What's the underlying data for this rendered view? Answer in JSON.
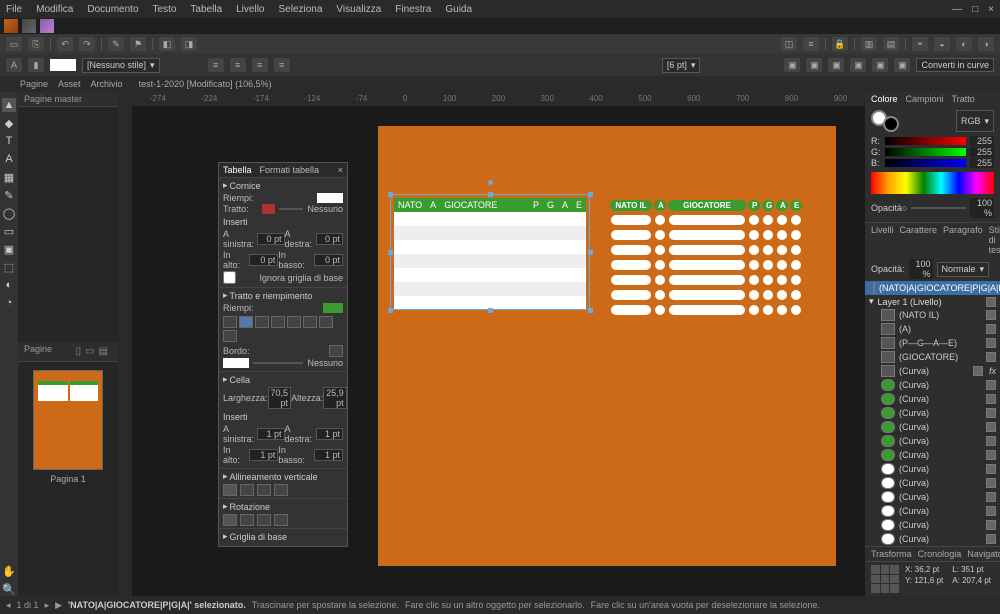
{
  "menu": [
    "File",
    "Modifica",
    "Documento",
    "Testo",
    "Tabella",
    "Livello",
    "Seleziona",
    "Visualizza",
    "Finestra",
    "Guida"
  ],
  "doc_tab": "test-1-2020 [Modificato] (106,5%)",
  "left_tabs": [
    "Pagine",
    "Asset",
    "Archivio"
  ],
  "lp_header": "Pagine master",
  "pages_header": "Pagine",
  "page_label": "Pagina 1",
  "toolbar2": {
    "style": "[Nessuno stile]",
    "size_combo": "[6 pt]",
    "curves": "Converti in curve"
  },
  "ruler": [
    "-274",
    "-224",
    "-174",
    "-124",
    "-74",
    "0",
    "100",
    "200",
    "300",
    "400",
    "500",
    "600",
    "700",
    "800",
    "900"
  ],
  "float": {
    "tabs": [
      "Tabella",
      "Formati tabella"
    ],
    "cornice": "Cornice",
    "riempi": "Riempi:",
    "tratto": "Tratto:",
    "nessuno": "Nessuno",
    "inserti": "Inserti",
    "asinistra": "A sinistra:",
    "adestra": "A destra:",
    "inalto": "In alto:",
    "inbasso": "In basso:",
    "pt0": "0 pt",
    "pt1": "1 pt",
    "ignora": "Ignora griglia di base",
    "tratto_riemp": "Tratto e riempimento",
    "bordo": "Bordo:",
    "cella": "Cella",
    "larghezza": "Larghezza:",
    "altezza": "Altezza:",
    "w": "70,5 pt",
    "h": "25,9 pt",
    "allin": "Allineamento verticale",
    "rot": "Rotazione",
    "griglia": "Griglia di base"
  },
  "tbl1": {
    "headers": [
      "NATO",
      "A",
      "GIOCATORE",
      "P",
      "G",
      "A",
      "E"
    ]
  },
  "tbl2": {
    "headers": [
      "NATO IL",
      "A",
      "GIOCATORE",
      "P",
      "G",
      "A",
      "E"
    ]
  },
  "color": {
    "tabs": [
      "Colore",
      "Campioni",
      "Tratto"
    ],
    "mode": "RGB",
    "r": "255",
    "g": "255",
    "b": "255",
    "opacita": "Opacità",
    "op_val": "100 %"
  },
  "layer_tabs": [
    "Livelli",
    "Carattere",
    "Paragrafo",
    "Stili di testo"
  ],
  "layer_opac": {
    "lbl": "Opacità:",
    "val": "100 %",
    "mode": "Normale"
  },
  "layers": [
    {
      "name": "(NATO|A|GIOCATORE|P|G|A|E)",
      "sel": true,
      "type": "grid"
    },
    {
      "name": "Layer 1 (Livello)",
      "type": "grp"
    },
    {
      "name": "(NATO IL)",
      "type": "grid"
    },
    {
      "name": "(A)",
      "type": "grid"
    },
    {
      "name": "(P—G—A—E)",
      "type": "grid"
    },
    {
      "name": "(GIOCATORE)",
      "type": "grid"
    },
    {
      "name": "(Curva)",
      "type": "curve"
    },
    {
      "name": "(Curva)",
      "type": "g"
    },
    {
      "name": "(Curva)",
      "type": "g"
    },
    {
      "name": "(Curva)",
      "type": "g"
    },
    {
      "name": "(Curva)",
      "type": "g"
    },
    {
      "name": "(Curva)",
      "type": "g"
    },
    {
      "name": "(Curva)",
      "type": "g"
    },
    {
      "name": "(Curva)",
      "type": "w"
    },
    {
      "name": "(Curva)",
      "type": "w"
    },
    {
      "name": "(Curva)",
      "type": "w"
    },
    {
      "name": "(Curva)",
      "type": "w"
    },
    {
      "name": "(Curva)",
      "type": "w"
    },
    {
      "name": "(Curva)",
      "type": "w"
    }
  ],
  "transform": {
    "tabs": [
      "Trasforma",
      "Cronologia",
      "Navigatore"
    ],
    "x": "36,2 pt",
    "y": "121,6 pt",
    "w": "351 pt",
    "h": "207,4 pt",
    "xl": "X:",
    "yl": "Y:",
    "wl": "L:",
    "hl": "A:"
  },
  "status": {
    "page": "1 di 1",
    "sel": "'NATO|A|GIOCATORE|P|G|A|' selezionato.",
    "drag": "Trascinare per spostare la selezione.",
    "click": "Fare clic su un altro oggetto per selezionarlo.",
    "empty": "Fare clic su un'area vuota per deselezionare la selezione."
  }
}
